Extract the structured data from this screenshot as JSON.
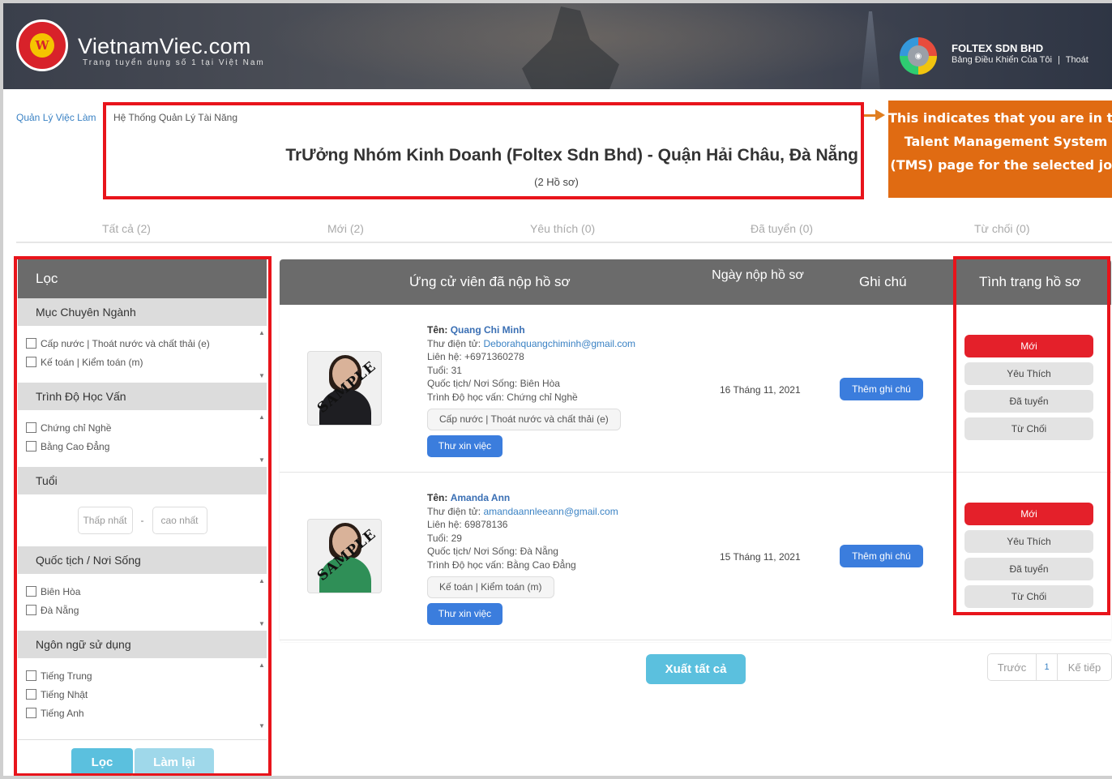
{
  "header": {
    "brand": "VietnamViec.com",
    "tagline": "Trang tuyển dụng số 1 tại Việt Nam",
    "logo_letter": "W",
    "company_name": "FOLTEX SDN BHD",
    "dashboard_link": "Bảng Điều Khiển Của Tôi",
    "separator": "|",
    "logout_link": "Thoát"
  },
  "breadcrumb": {
    "parent": "Quản Lý Việc Làm",
    "current": "Hệ Thống Quản Lý Tài Năng"
  },
  "job": {
    "title": "TrƯởng Nhóm Kinh Doanh (Foltex Sdn Bhd) - Quận Hải Châu, Đà Nẵng",
    "count": "(2 Hồ sơ)"
  },
  "callout": {
    "line1": "This indicates that you are in the",
    "line2": "Talent Management System",
    "line3": "(TMS) page for the selected job"
  },
  "tabs": [
    {
      "label": "Tất cả (2)"
    },
    {
      "label": "Mới (2)"
    },
    {
      "label": "Yêu thích (0)"
    },
    {
      "label": "Đã tuyển (0)"
    },
    {
      "label": "Từ chối (0)"
    }
  ],
  "filter": {
    "title": "Lọc",
    "sections": {
      "industry": {
        "title": "Mục Chuyên Ngành",
        "items": [
          "Cấp nước | Thoát nước và chất thải (e)",
          "Kế toán | Kiểm toán (m)"
        ]
      },
      "education": {
        "title": "Trình Độ Học Vấn",
        "items": [
          "Chứng chỉ Nghề",
          "Bằng Cao Đẳng"
        ]
      },
      "age": {
        "title": "Tuổi",
        "min_placeholder": "Thấp nhất",
        "dash": "-",
        "max_placeholder": "cao nhất"
      },
      "nationality": {
        "title": "Quốc tịch / Nơi Sống",
        "items": [
          "Biên Hòa",
          "Đà Nẵng"
        ]
      },
      "language": {
        "title": "Ngôn ngữ sử dụng",
        "items": [
          "Tiếng Trung",
          "Tiếng Nhật",
          "Tiếng Anh"
        ]
      }
    },
    "apply_label": "Lọc",
    "reset_label": "Làm lại"
  },
  "table": {
    "headers": {
      "candidate": "Ứng cử viên đã nộp hồ sơ",
      "date": "Ngày nộp hồ sơ",
      "note": "Ghi chú",
      "status": "Tình trạng hồ sơ"
    },
    "labels": {
      "name": "Tên:",
      "email": "Thư điện tử:",
      "phone": "Liên hệ:",
      "age": "Tuổi:",
      "nationality": "Quốc tịch/ Nơi Sống:",
      "education": "Trình Độ học vấn:",
      "letter_button": "Thư xin việc",
      "note_button": "Thêm ghi chú",
      "sample": "SAMPLE"
    },
    "status_options": [
      "Mới",
      "Yêu Thích",
      "Đã tuyển",
      "Từ Chối"
    ],
    "rows": [
      {
        "name": "Quang Chi Minh",
        "email": "Deborahquangchiminh@gmail.com",
        "phone": "+6971360278",
        "age": "31",
        "nationality": "Biên Hòa",
        "education": "Chứng chỉ Nghề",
        "tag": "Cấp nước | Thoát nước và chất thải (e)",
        "date": "16 Tháng 11, 2021",
        "current_status": "Mới"
      },
      {
        "name": "Amanda Ann",
        "email": "amandaannleeann@gmail.com",
        "phone": "69878136",
        "age": "29",
        "nationality": "Đà Nẵng",
        "education": "Bằng Cao Đẳng",
        "tag": "Kế toán | Kiểm toán (m)",
        "date": "15 Tháng 11, 2021",
        "current_status": "Mới"
      }
    ]
  },
  "footer": {
    "export_label": "Xuất tất cả",
    "pager": {
      "prev": "Trước",
      "page": "1",
      "next": "Kế tiếp"
    }
  },
  "colors": {
    "annotation_red": "#e8141b",
    "callout_orange": "#e06b12",
    "status_new": "#e4202a",
    "primary_blue": "#3b7ddd",
    "light_blue": "#5bc0de",
    "header_gray": "#6b6b6b"
  }
}
